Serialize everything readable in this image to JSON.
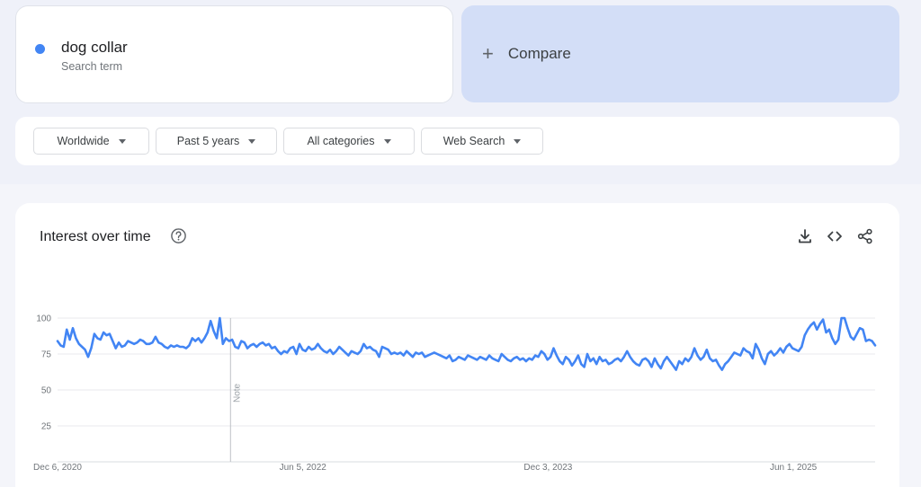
{
  "search_term": {
    "name": "dog collar",
    "subtitle": "Search term",
    "color": "#4285f4"
  },
  "compare": {
    "label": "Compare"
  },
  "filters": [
    {
      "label": "Worldwide"
    },
    {
      "label": "Past 5 years"
    },
    {
      "label": "All categories"
    },
    {
      "label": "Web Search"
    }
  ],
  "chart": {
    "title": "Interest over time",
    "note_label": "Note",
    "icons": [
      "download-icon",
      "embed-code-icon",
      "share-icon"
    ]
  },
  "chart_data": {
    "type": "line",
    "title": "",
    "xlabel": "",
    "ylabel": "",
    "ylim": [
      0,
      100
    ],
    "grid": true,
    "yticks": [
      25,
      50,
      75,
      100
    ],
    "xticks": [
      {
        "label": "Dec 6, 2020",
        "date": "2020-12-06"
      },
      {
        "label": "Jun 5, 2022",
        "date": "2022-06-05"
      },
      {
        "label": "Dec 3, 2023",
        "date": "2023-12-03"
      },
      {
        "label": "Jun 1, 2025",
        "date": "2025-06-01"
      }
    ],
    "x_start": "2020-12-06",
    "x_end": "2025-11-30",
    "note_date": "2021-12-26",
    "series": [
      {
        "name": "dog collar",
        "color": "#4285f4",
        "values": [
          84,
          81,
          80,
          92,
          85,
          93,
          86,
          82,
          80,
          78,
          73,
          79,
          89,
          86,
          85,
          90,
          88,
          89,
          84,
          79,
          83,
          80,
          81,
          84,
          83,
          82,
          83,
          85,
          84,
          82,
          82,
          83,
          87,
          83,
          82,
          80,
          79,
          81,
          80,
          81,
          80,
          80,
          79,
          81,
          86,
          84,
          86,
          83,
          86,
          90,
          98,
          91,
          86,
          100,
          82,
          86,
          84,
          85,
          80,
          79,
          84,
          83,
          79,
          81,
          82,
          80,
          82,
          83,
          81,
          82,
          79,
          80,
          77,
          75,
          77,
          76,
          79,
          80,
          75,
          82,
          78,
          77,
          80,
          78,
          79,
          82,
          79,
          77,
          76,
          78,
          75,
          77,
          80,
          78,
          76,
          74,
          77,
          76,
          75,
          77,
          82,
          79,
          80,
          78,
          77,
          73,
          80,
          79,
          78,
          75,
          76,
          75,
          76,
          74,
          77,
          75,
          73,
          76,
          75,
          76,
          73,
          74,
          75,
          76,
          75,
          74,
          73,
          72,
          74,
          70,
          71,
          73,
          72,
          71,
          74,
          73,
          72,
          71,
          73,
          72,
          71,
          74,
          72,
          71,
          70,
          75,
          73,
          71,
          70,
          72,
          73,
          71,
          72,
          70,
          72,
          71,
          74,
          73,
          77,
          75,
          71,
          73,
          79,
          74,
          70,
          68,
          73,
          71,
          67,
          70,
          74,
          68,
          66,
          75,
          70,
          72,
          68,
          73,
          70,
          71,
          68,
          69,
          71,
          72,
          70,
          73,
          77,
          73,
          70,
          68,
          67,
          71,
          72,
          70,
          66,
          72,
          68,
          65,
          70,
          73,
          70,
          67,
          64,
          70,
          68,
          72,
          70,
          73,
          79,
          74,
          71,
          73,
          78,
          72,
          70,
          71,
          67,
          64,
          68,
          70,
          73,
          76,
          75,
          74,
          79,
          77,
          76,
          72,
          82,
          78,
          72,
          68,
          75,
          77,
          74,
          76,
          79,
          76,
          80,
          82,
          79,
          78,
          77,
          80,
          88,
          92,
          95,
          97,
          92,
          96,
          99,
          90,
          92,
          86,
          82,
          85,
          100,
          100,
          93,
          87,
          85,
          89,
          93,
          92,
          84,
          85,
          84,
          81
        ]
      }
    ]
  }
}
